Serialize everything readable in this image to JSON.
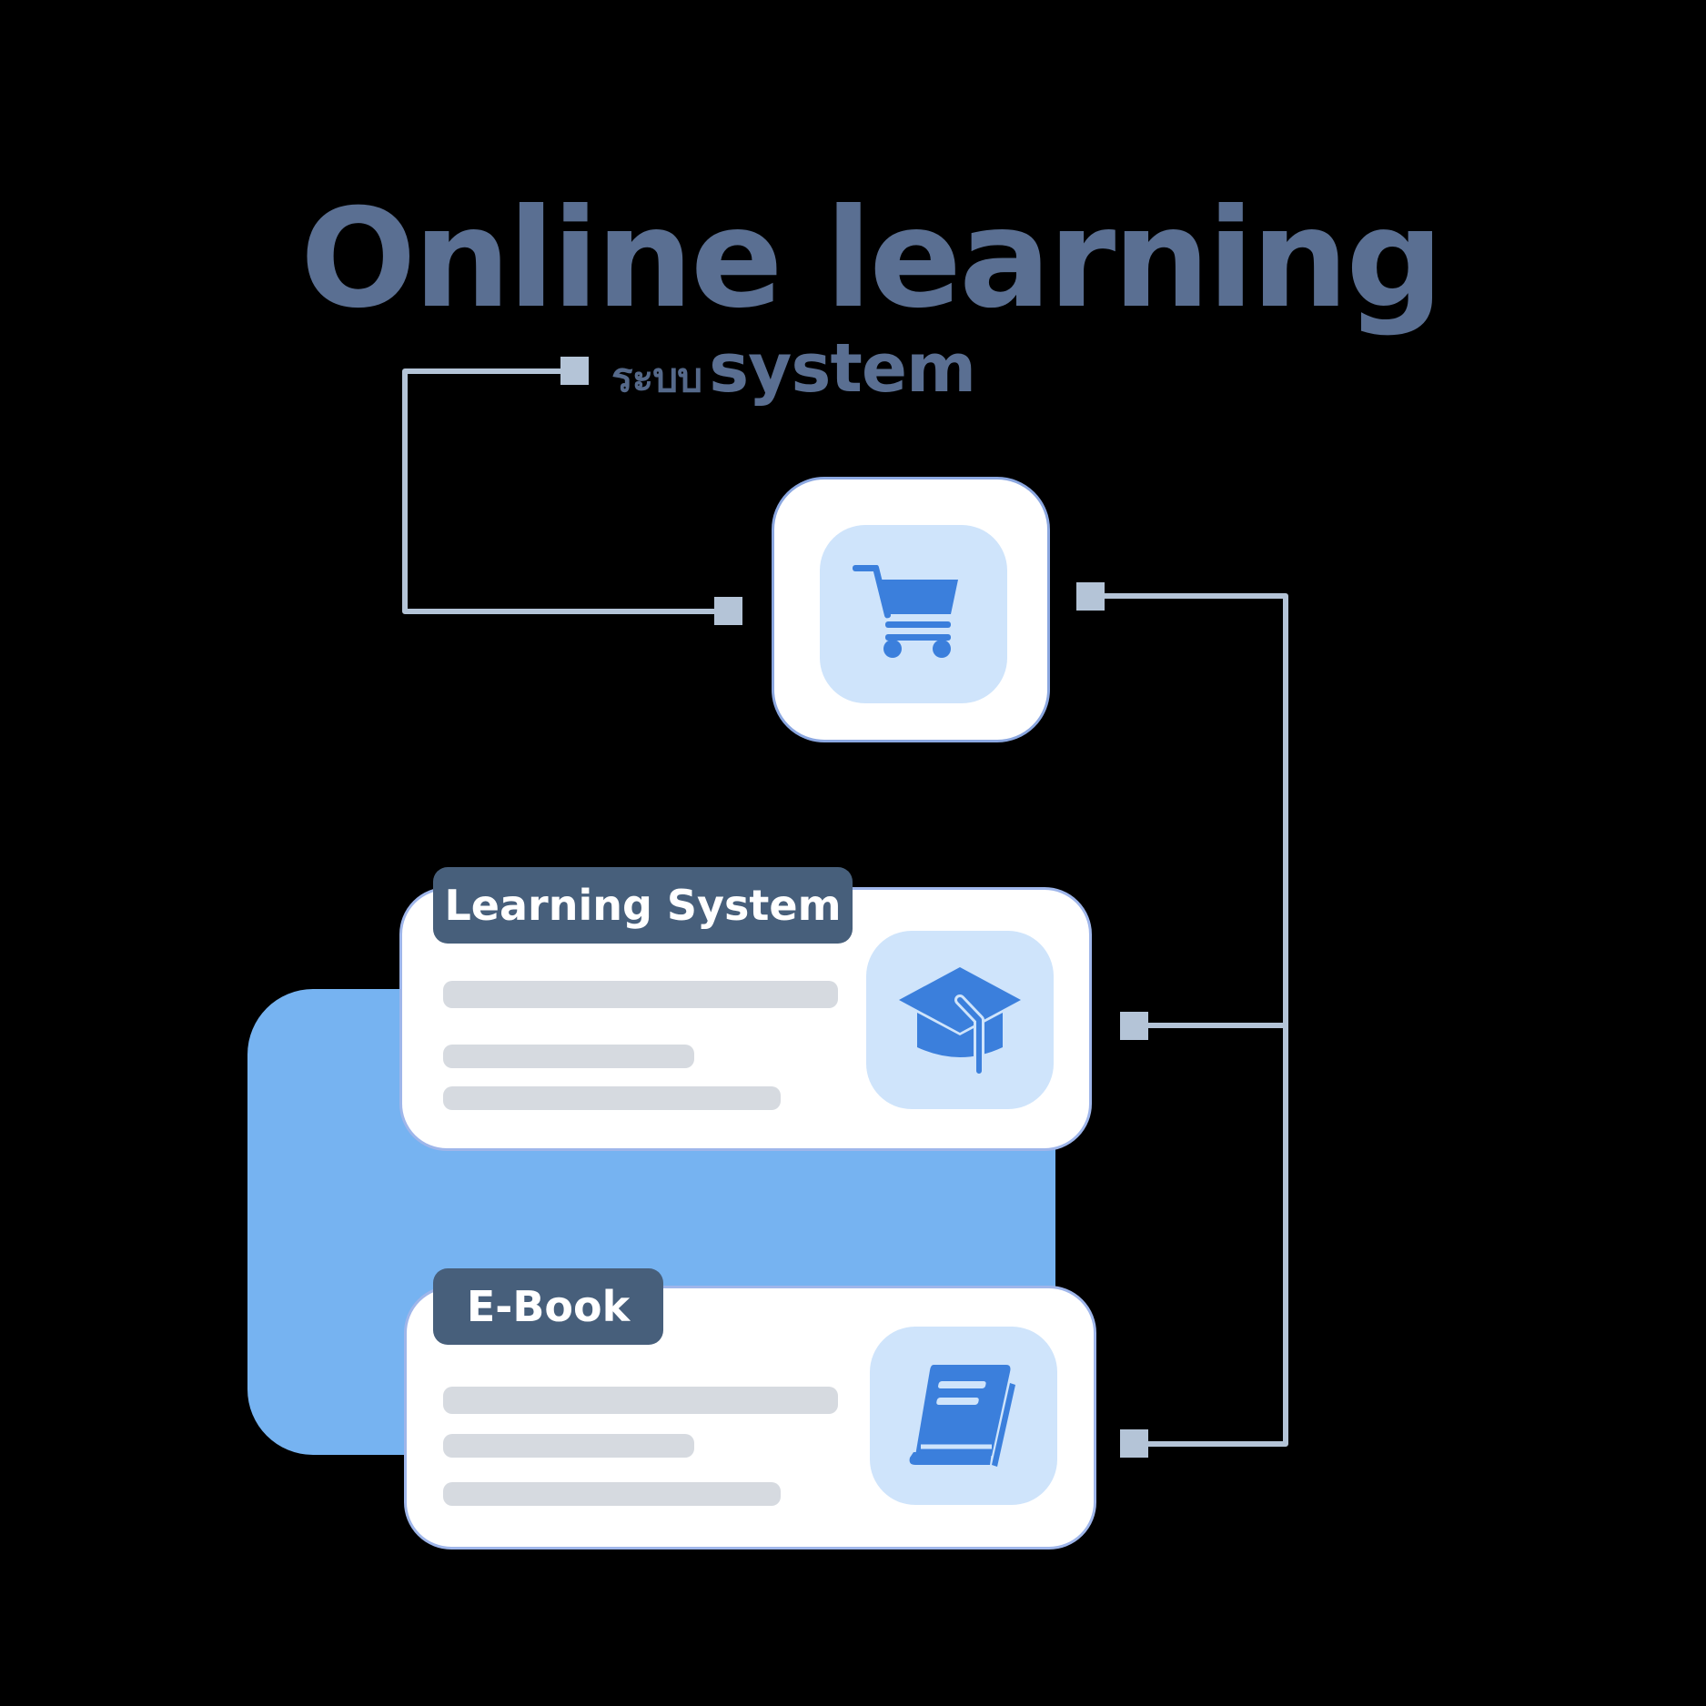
{
  "title": "Online learning",
  "subtitle": {
    "prefix": "ระบบ",
    "main": "system"
  },
  "nodes": {
    "hub": {
      "icon": "shopping-cart-icon"
    },
    "learning_system": {
      "label": "Learning System",
      "icon": "graduation-cap-icon"
    },
    "ebook": {
      "label": "E-Book",
      "icon": "book-icon"
    }
  },
  "colors": {
    "background": "#000000",
    "title": "#5a6f92",
    "connector": "#b4c4d7",
    "accent_blue": "#3b7fdc",
    "tile_bg": "#cfe4fb",
    "panel_blue": "#76b3f1",
    "label_bg": "#475f7b",
    "placeholder_bar": "#d6dae0"
  }
}
